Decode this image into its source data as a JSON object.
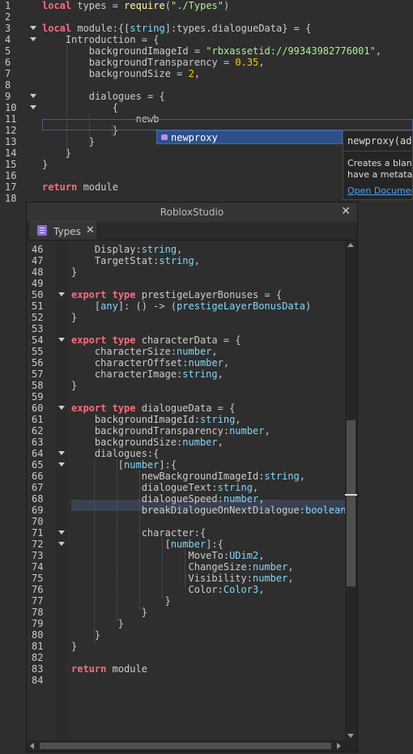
{
  "main_editor": {
    "lines": [
      {
        "n": "1",
        "html": "<span class=\"kw\">local</span> types = <span class=\"fn\">require</span>(<span class=\"str\">\"./Types\"</span>)"
      },
      {
        "n": "2",
        "html": ""
      },
      {
        "n": "3",
        "html": "<span class=\"kw\">local</span> module:{[<span class=\"typ\">string</span>]:types.dialogueData} = {"
      },
      {
        "n": "4",
        "html": "    Introduction = {"
      },
      {
        "n": "5",
        "html": "        backgroundImageId = <span class=\"str\">\"rbxassetid://99343982776001\"</span>,"
      },
      {
        "n": "6",
        "html": "        backgroundTransparency = <span class=\"num\">0.35</span>,"
      },
      {
        "n": "7",
        "html": "        backgroundSize = <span class=\"num\">2</span>,"
      },
      {
        "n": "8",
        "html": ""
      },
      {
        "n": "9",
        "html": "        dialogues = {"
      },
      {
        "n": "10",
        "html": "            {"
      },
      {
        "n": "11",
        "html": "                newb"
      },
      {
        "n": "12",
        "html": "            }"
      },
      {
        "n": "13",
        "html": "        }"
      },
      {
        "n": "14",
        "html": "    }"
      },
      {
        "n": "15",
        "html": "}"
      },
      {
        "n": "16",
        "html": ""
      },
      {
        "n": "17",
        "html": "<span class=\"kw\">return</span> module"
      },
      {
        "n": "18",
        "html": ""
      }
    ],
    "fold_lines": [
      3,
      4,
      9,
      10
    ]
  },
  "autocomplete": {
    "item": "newproxy",
    "signature": "newproxy(add",
    "description": "Creates a blank u\nhave a metatabl",
    "doc_link": "Open Document"
  },
  "window": {
    "title": "RobloxStudio",
    "close_glyph": "✕",
    "tab_label": "Types",
    "tab_close": "✕"
  },
  "types_editor": {
    "lines": [
      {
        "n": "46",
        "html": "    Display:<span class=\"typ\">string</span>,"
      },
      {
        "n": "47",
        "html": "    TargetStat:<span class=\"typ\">string</span>,"
      },
      {
        "n": "48",
        "html": "}"
      },
      {
        "n": "49",
        "html": ""
      },
      {
        "n": "50",
        "html": "<span class=\"exp\">export</span> <span class=\"kw\">type</span> prestigeLayerBonuses = {"
      },
      {
        "n": "51",
        "html": "    [<span class=\"typ\">any</span>]: () -> (<span class=\"typ\">prestigeLayerBonusData</span>)"
      },
      {
        "n": "52",
        "html": "}"
      },
      {
        "n": "53",
        "html": ""
      },
      {
        "n": "54",
        "html": "<span class=\"exp\">export</span> <span class=\"kw\">type</span> characterData = {"
      },
      {
        "n": "55",
        "html": "    characterSize:<span class=\"typ\">number</span>,"
      },
      {
        "n": "56",
        "html": "    characterOffset:<span class=\"typ\">number</span>,"
      },
      {
        "n": "57",
        "html": "    characterImage:<span class=\"typ\">string</span>,"
      },
      {
        "n": "58",
        "html": "}"
      },
      {
        "n": "59",
        "html": ""
      },
      {
        "n": "60",
        "html": "<span class=\"exp\">export</span> <span class=\"kw\">type</span> dialogueData = {"
      },
      {
        "n": "61",
        "html": "    backgroundImageId:<span class=\"typ\">string</span>,"
      },
      {
        "n": "62",
        "html": "    backgroundTransparency:<span class=\"typ\">number</span>,"
      },
      {
        "n": "63",
        "html": "    backgroundSize:<span class=\"typ\">number</span>,"
      },
      {
        "n": "64",
        "html": "    dialogues:{"
      },
      {
        "n": "65",
        "html": "        [<span class=\"typ\">number</span>]:{"
      },
      {
        "n": "66",
        "html": "            newBackgroundImageId:<span class=\"typ\">string</span>,"
      },
      {
        "n": "67",
        "html": "            dialogueText:<span class=\"typ\">string</span>,"
      },
      {
        "n": "68",
        "html": "            dialogueSpeed:<span class=\"typ\">number</span>,"
      },
      {
        "n": "69",
        "html": "            breakDialogueOnNextDialogue:<span class=\"typ\">boolean</span>,"
      },
      {
        "n": "70",
        "html": ""
      },
      {
        "n": "71",
        "html": "            character:{"
      },
      {
        "n": "72",
        "html": "                [<span class=\"typ\">number</span>]:{"
      },
      {
        "n": "73",
        "html": "                    MoveTo:<span class=\"typ\">UDim2</span>,"
      },
      {
        "n": "74",
        "html": "                    ChangeSize:<span class=\"typ\">number</span>,"
      },
      {
        "n": "75",
        "html": "                    Visibility:<span class=\"typ\">number</span>,"
      },
      {
        "n": "76",
        "html": "                    Color:<span class=\"typ\">Color3</span>,"
      },
      {
        "n": "77",
        "html": "                }"
      },
      {
        "n": "78",
        "html": "            }"
      },
      {
        "n": "79",
        "html": "        }"
      },
      {
        "n": "80",
        "html": "    }"
      },
      {
        "n": "81",
        "html": "}"
      },
      {
        "n": "82",
        "html": ""
      },
      {
        "n": "83",
        "html": "<span class=\"kw\">return</span> module"
      },
      {
        "n": "84",
        "html": ""
      }
    ],
    "fold_lines": [
      50,
      54,
      60,
      64,
      65,
      71,
      72
    ]
  }
}
